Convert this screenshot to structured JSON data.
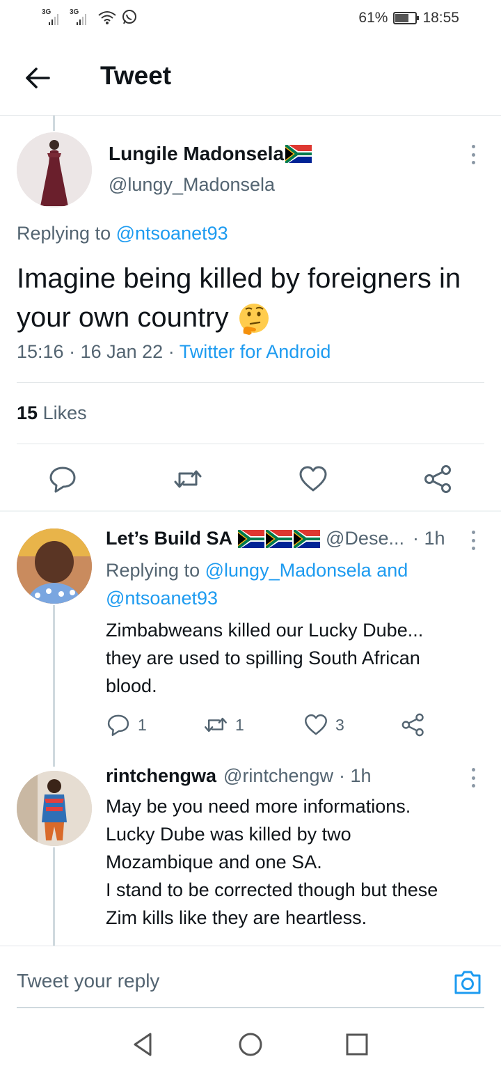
{
  "status_bar": {
    "net1": "3G",
    "net2": "3G",
    "battery_text": "61%",
    "battery_level": 0.61,
    "time": "18:55"
  },
  "header": {
    "title": "Tweet"
  },
  "main_tweet": {
    "author_name": "Lungile Madonsela",
    "author_handle": "@lungy_Madonsela",
    "replying_prefix": "Replying to",
    "replying_to": "@ntsoanet93",
    "text": "Imagine being killed by foreigners in your own country",
    "time": "15:16",
    "date": "16 Jan 22",
    "source": "Twitter for Android",
    "likes_count": "15",
    "likes_label": "Likes"
  },
  "replies": [
    {
      "author_name": "Let’s Build SA",
      "author_handle": "@Dese...",
      "time": "1h",
      "replying_prefix": "Replying to",
      "replying_to_1": "@lungy_Madonsela",
      "replying_and": "and",
      "replying_to_2": "@ntsoanet93",
      "text_lines": [
        "Zimbabweans killed our Lucky Dube...",
        "they are used to spilling South African",
        "blood."
      ],
      "reply_count": "1",
      "retweet_count": "1",
      "like_count": "3"
    },
    {
      "author_name": "rintchengwa",
      "author_handle": "@rintchengw",
      "time": "1h",
      "text_lines": [
        "May be you need more informations.",
        "Lucky Dube was killed by  two",
        "Mozambique and one SA.",
        "I stand to be corrected  though but these",
        "Zim kills like they are heartless."
      ]
    }
  ],
  "compose": {
    "placeholder": "Tweet your reply"
  },
  "icons": {
    "back": "arrow-left-icon",
    "more": "more-vertical-icon",
    "reply": "reply-icon",
    "retweet": "retweet-icon",
    "like": "heart-icon",
    "share": "share-icon",
    "camera": "camera-icon",
    "nav_back": "triangle-back-icon",
    "nav_home": "circle-home-icon",
    "nav_recents": "square-recents-icon"
  },
  "colors": {
    "accent": "#1d9bf0",
    "text": "#0f1419",
    "secondary": "#536471",
    "divider": "#e1e5e8"
  }
}
